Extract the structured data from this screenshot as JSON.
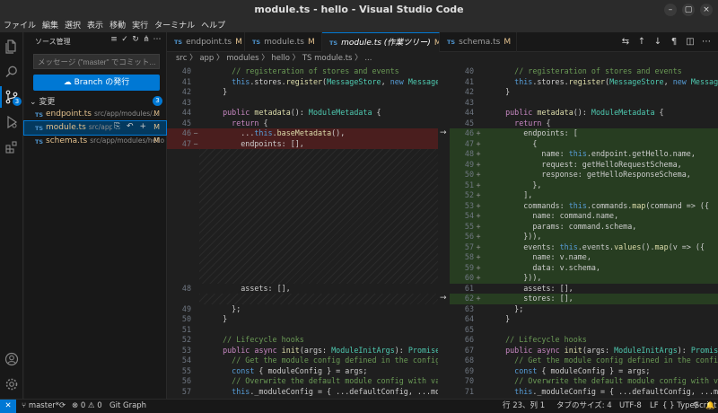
{
  "window": {
    "title": "module.ts - hello - Visual Studio Code",
    "min": "–",
    "max": "▢",
    "close": "×"
  },
  "menu": [
    "ファイル",
    "編集",
    "選択",
    "表示",
    "移動",
    "実行",
    "ターミナル",
    "ヘルプ"
  ],
  "activity_bar": {
    "items": [
      "files-icon",
      "search-icon",
      "source-control-icon",
      "run-debug-icon",
      "extensions-icon"
    ],
    "scm_badge": "3",
    "bottom": [
      "account-icon",
      "manage-gear-icon"
    ]
  },
  "sidebar": {
    "header": "ソース管理",
    "tools": [
      "≡",
      "✓",
      "↻",
      "⋔",
      "⋯"
    ],
    "commit_placeholder": "メッセージ (\"master\" でコミット...",
    "publish_button": "Branch の発行",
    "changes_label": "変更",
    "changes_count": "3",
    "files": [
      {
        "badge": "TS",
        "name": "endpoint.ts",
        "path": "src/app/modules/...",
        "status": "M"
      },
      {
        "badge": "TS",
        "name": "module.ts",
        "path": "src/app/...",
        "status": "M",
        "tools": "⎘ ↶ +"
      },
      {
        "badge": "TS",
        "name": "schema.ts",
        "path": "src/app/modules/hello",
        "status": "M"
      }
    ]
  },
  "tabs": [
    {
      "badge": "TS",
      "name": "endpoint.ts",
      "mod": "M"
    },
    {
      "badge": "TS",
      "name": "module.ts",
      "mod": "M"
    },
    {
      "badge": "TS",
      "name": "module.ts (作業ツリー)",
      "mod": "M",
      "close": "×"
    },
    {
      "badge": "TS",
      "name": "schema.ts",
      "mod": "M"
    }
  ],
  "editor_tools": [
    "⇆",
    "↑",
    "↓",
    "¶",
    "◫",
    "⋯"
  ],
  "breadcrumb": "src 〉 app 〉 modules 〉 hello 〉 TS module.ts 〉 ...",
  "left_lines": [
    {
      "n": "40",
      "m": "",
      "code": "    // registeration of stores and events"
    },
    {
      "n": "41",
      "m": "",
      "code": "    this.stores.register(MessageStore, new MessageStore(t"
    },
    {
      "n": "42",
      "m": "",
      "code": "  }"
    },
    {
      "n": "43",
      "m": "",
      "code": ""
    },
    {
      "n": "44",
      "m": "",
      "code": "  public metadata(): ModuleMetadata {"
    },
    {
      "n": "45",
      "m": "",
      "code": "    return {"
    },
    {
      "n": "46",
      "m": "−",
      "code": "      ...this.baseMetadata(),"
    },
    {
      "n": "47",
      "m": "−",
      "code": "      endpoints: [],"
    },
    {
      "n": "48",
      "m": "",
      "code": "      assets: [],"
    },
    {
      "n": "49",
      "m": "",
      "code": "    };"
    },
    {
      "n": "50",
      "m": "",
      "code": "  }"
    },
    {
      "n": "51",
      "m": "",
      "code": ""
    },
    {
      "n": "52",
      "m": "",
      "code": "  // Lifecycle hooks"
    },
    {
      "n": "53",
      "m": "",
      "code": "  public async init(args: ModuleInitArgs): Promise<void> {"
    },
    {
      "n": "54",
      "m": "",
      "code": "    // Get the module config defined in the config.json c"
    },
    {
      "n": "55",
      "m": "",
      "code": "    const { moduleConfig } = args;"
    },
    {
      "n": "56",
      "m": "",
      "code": "    // Overwrite the default module config with values fr"
    },
    {
      "n": "57",
      "m": "",
      "code": "    this._moduleConfig = { ...defaultConfig, ...moduleConf"
    }
  ],
  "right_lines": [
    {
      "n": "40",
      "m": "",
      "code": "    // registeration of stores and events"
    },
    {
      "n": "41",
      "m": "",
      "code": "    this.stores.register(MessageStore, new MessageStore(t"
    },
    {
      "n": "42",
      "m": "",
      "code": "  }"
    },
    {
      "n": "43",
      "m": "",
      "code": ""
    },
    {
      "n": "44",
      "m": "",
      "code": "  public metadata(): ModuleMetadata {"
    },
    {
      "n": "45",
      "m": "",
      "code": "    return {"
    },
    {
      "n": "46",
      "m": "+",
      "code": "      endpoints: ["
    },
    {
      "n": "47",
      "m": "+",
      "code": "        {"
    },
    {
      "n": "48",
      "m": "+",
      "code": "          name: this.endpoint.getHello.name,"
    },
    {
      "n": "49",
      "m": "+",
      "code": "          request: getHelloRequestSchema,"
    },
    {
      "n": "50",
      "m": "+",
      "code": "          response: getHelloResponseSchema,"
    },
    {
      "n": "51",
      "m": "+",
      "code": "        },"
    },
    {
      "n": "52",
      "m": "+",
      "code": "      ],"
    },
    {
      "n": "53",
      "m": "+",
      "code": "      commands: this.commands.map(command => ({"
    },
    {
      "n": "54",
      "m": "+",
      "code": "        name: command.name,"
    },
    {
      "n": "55",
      "m": "+",
      "code": "        params: command.schema,"
    },
    {
      "n": "56",
      "m": "+",
      "code": "      })),"
    },
    {
      "n": "57",
      "m": "+",
      "code": "      events: this.events.values().map(v => ({"
    },
    {
      "n": "58",
      "m": "+",
      "code": "        name: v.name,"
    },
    {
      "n": "59",
      "m": "+",
      "code": "        data: v.schema,"
    },
    {
      "n": "60",
      "m": "+",
      "code": "      })),"
    },
    {
      "n": "61",
      "m": "",
      "code": "      assets: [],"
    },
    {
      "n": "62",
      "m": "+",
      "code": "      stores: [],"
    },
    {
      "n": "63",
      "m": "",
      "code": "    };"
    },
    {
      "n": "64",
      "m": "",
      "code": "  }"
    },
    {
      "n": "65",
      "m": "",
      "code": ""
    },
    {
      "n": "66",
      "m": "",
      "code": "  // Lifecycle hooks"
    },
    {
      "n": "67",
      "m": "",
      "code": "  public async init(args: ModuleInitArgs): Promise<void> {"
    },
    {
      "n": "68",
      "m": "",
      "code": "    // Get the module config defined in the config.json c"
    },
    {
      "n": "69",
      "m": "",
      "code": "    const { moduleConfig } = args;"
    },
    {
      "n": "70",
      "m": "",
      "code": "    // Overwrite the default module config with values fr"
    },
    {
      "n": "71",
      "m": "",
      "code": "    this._moduleConfig = { ...defaultConfig, ...moduleConf"
    }
  ],
  "gutter_arrow": "→",
  "status": {
    "remote": "✕",
    "branch": "master*",
    "sync": "⟳",
    "problems": "⊗ 0 ⚠ 0",
    "git_graph": "Git Graph",
    "position": "行 23、列 1",
    "tab_size": "タブのサイズ: 4",
    "encoding": "UTF-8",
    "eol": "LF",
    "language": "{ } TypeScript",
    "feedback": "⚲",
    "bell": "🔔"
  },
  "colors": {
    "accent": "#0078d4",
    "added": "#2d5523",
    "deleted": "#6e1e1e",
    "modified": "#e2c08d"
  }
}
